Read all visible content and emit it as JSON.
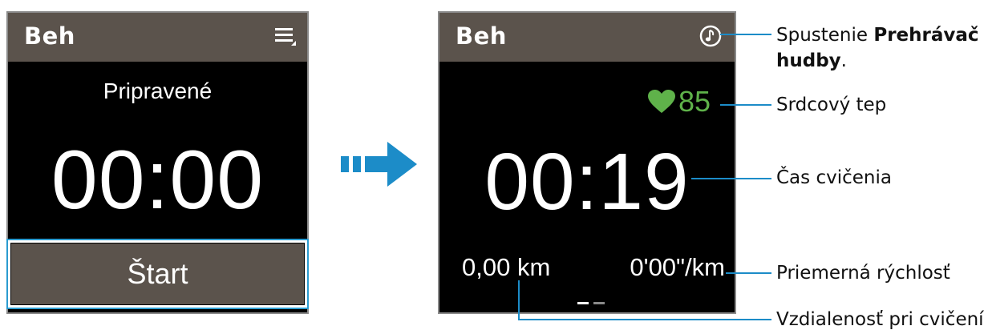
{
  "app_title": "Beh",
  "ready_screen": {
    "status": "Pripravené",
    "timer": "00:00",
    "start_label": "Štart"
  },
  "running_screen": {
    "timer": "00:19",
    "heart_rate": "85",
    "distance": "0,00 km",
    "pace": "0'00\"/km"
  },
  "callouts": {
    "music_prefix": "Spustenie ",
    "music_bold_line1": "Prehrávač",
    "music_bold_line2": "hudby",
    "music_suffix": ".",
    "heart_rate": "Srdcový tep",
    "exercise_time": "Čas cvičenia",
    "avg_speed": "Priemerná rýchlosť",
    "distance": "Vzdialenosť pri cvičení"
  },
  "colors": {
    "title_bar": "#5b534c",
    "accent_blue": "#1c8cc8",
    "heart_green": "#5fb24a"
  },
  "icons": [
    "menu-icon",
    "music-icon",
    "heart-icon",
    "arrow-icon"
  ]
}
